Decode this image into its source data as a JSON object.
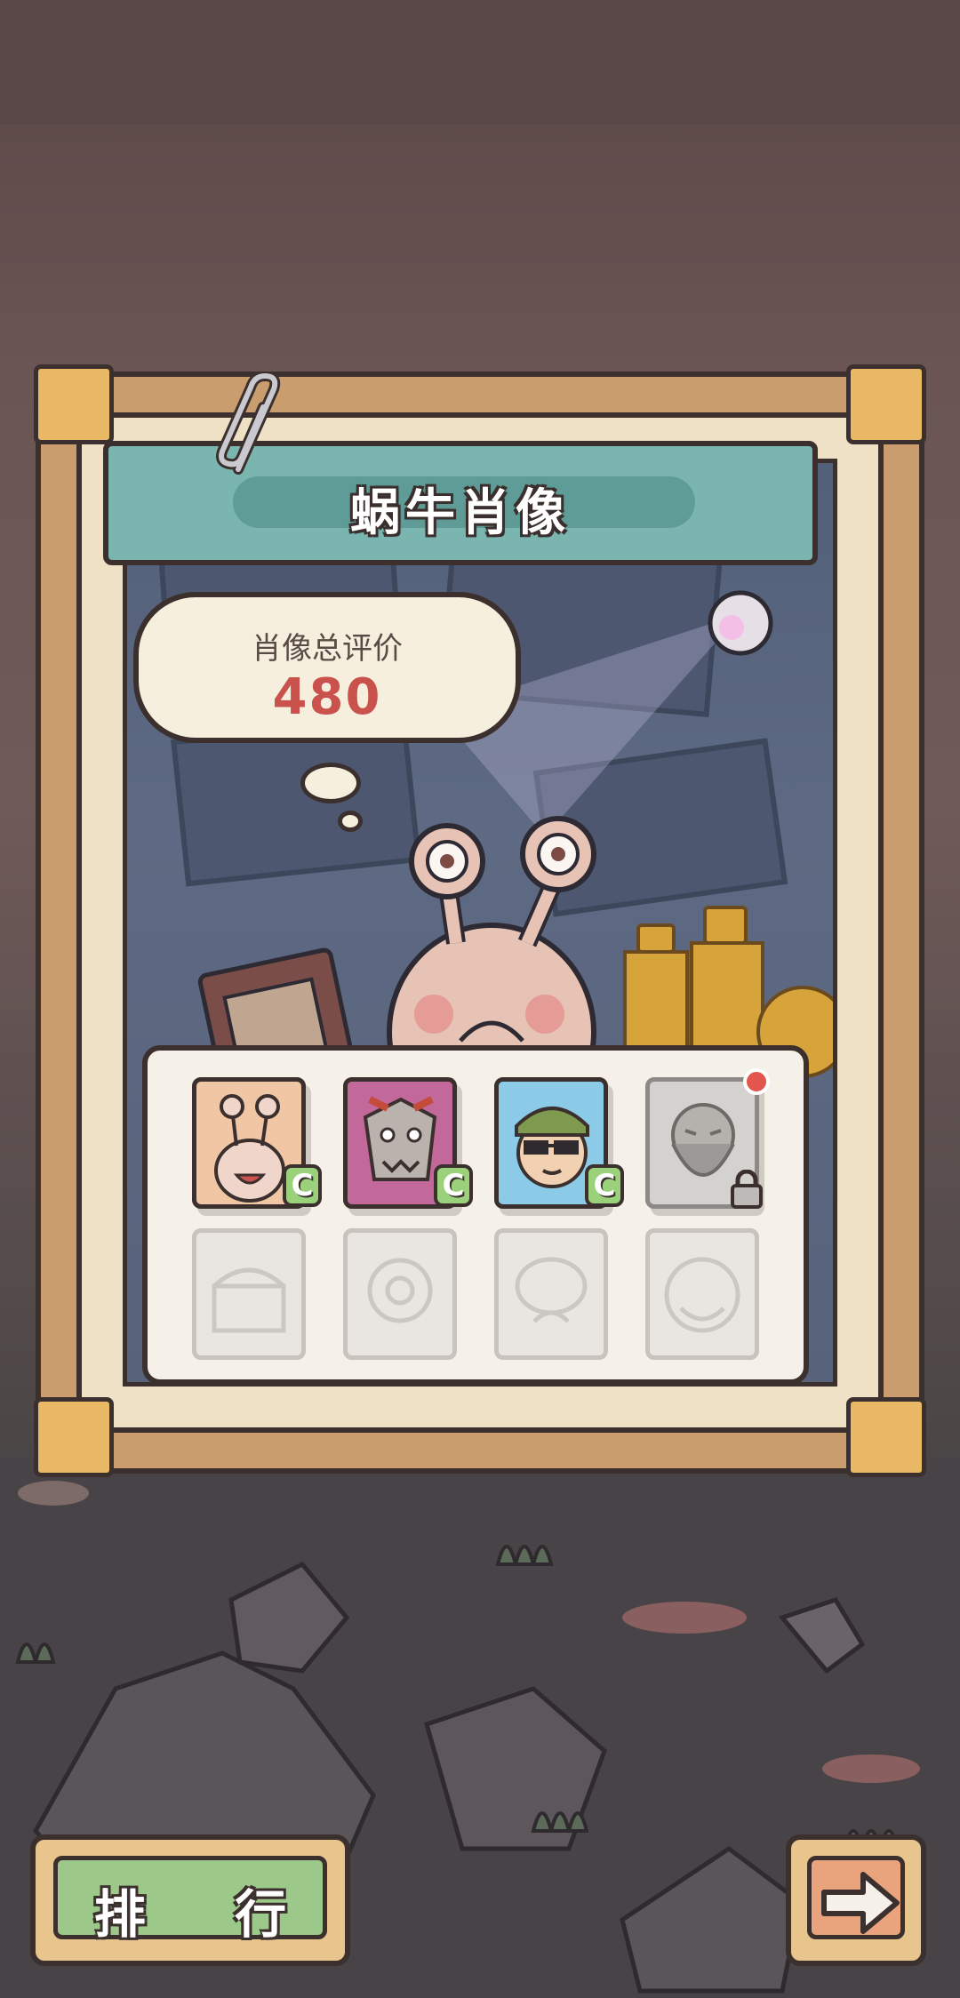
{
  "title": "蜗牛肖像",
  "rating": {
    "label": "肖像总评价",
    "value": "480"
  },
  "portraits": [
    {
      "name": "snail-portrait",
      "grade": "C",
      "unlocked": true
    },
    {
      "name": "dragon-portrait",
      "grade": "C",
      "unlocked": true
    },
    {
      "name": "cool-guy-portrait",
      "grade": "C",
      "unlocked": true,
      "selected": true
    },
    {
      "name": "bearded-man-portrait",
      "unlocked": false,
      "notification": true
    },
    {
      "name": "treasure-chest-portrait",
      "unlocked": false
    },
    {
      "name": "flower-portrait",
      "unlocked": false
    },
    {
      "name": "brain-creature-portrait",
      "unlocked": false
    },
    {
      "name": "pumpkin-face-portrait",
      "unlocked": false
    }
  ],
  "buttons": {
    "rank": "排 行",
    "next": "arrow-right-icon"
  },
  "colors": {
    "frame": "#c99d6d",
    "banner": "#7ab5b0",
    "rating_value": "#c9524c",
    "grade_badge": "#9ad17a",
    "rank_button": "#9cc88a",
    "next_button": "#e9a47e",
    "notification": "#e3564d"
  }
}
